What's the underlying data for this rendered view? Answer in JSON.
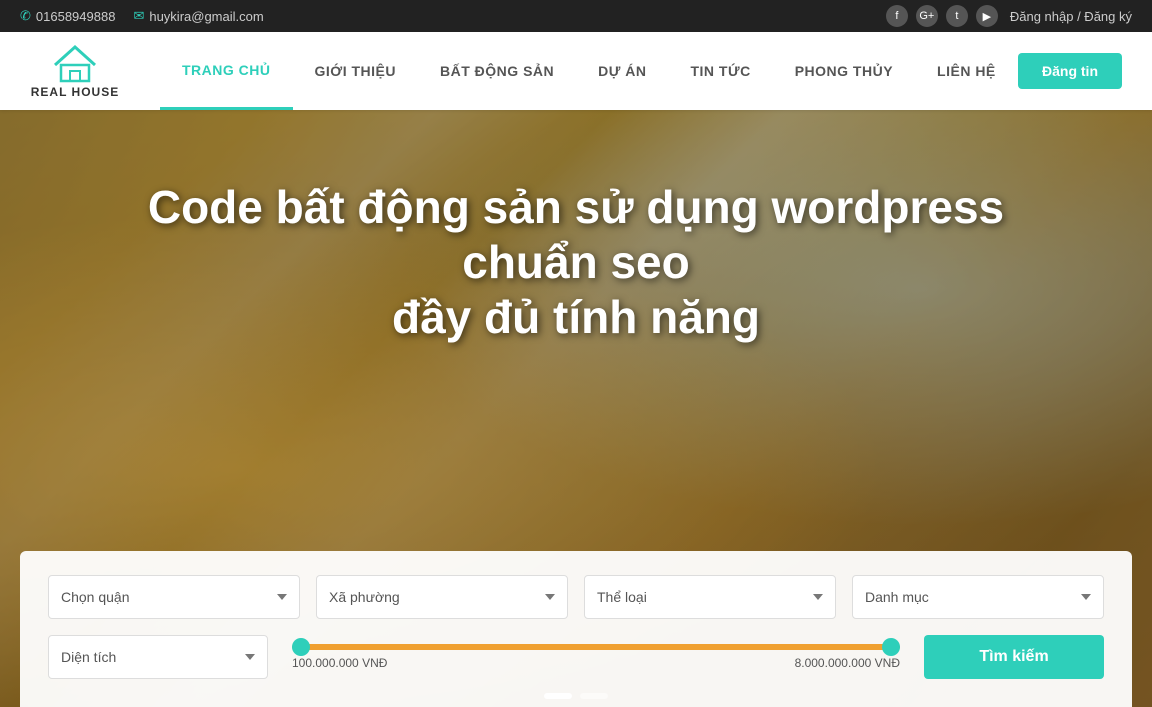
{
  "topbar": {
    "phone": "01658949888",
    "email": "huykira@gmail.com",
    "login": "Đăng nhập / Đăng ký",
    "socials": [
      "f",
      "G+",
      "t",
      "y"
    ]
  },
  "header": {
    "logo_text": "REAL HOUSE",
    "dang_tin": "Đăng tin",
    "nav": [
      {
        "label": "TRANG CHỦ",
        "active": true
      },
      {
        "label": "GIỚI THIỆU",
        "active": false
      },
      {
        "label": "BẤT ĐỘNG SẢN",
        "active": false
      },
      {
        "label": "DỰ ÁN",
        "active": false
      },
      {
        "label": "TIN TỨC",
        "active": false
      },
      {
        "label": "PHONG THỦY",
        "active": false
      },
      {
        "label": "LIÊN HỆ",
        "active": false
      }
    ]
  },
  "hero": {
    "title_line1": "Code bất động sản sử dụng wordpress chuẩn seo",
    "title_line2": "đầy đủ tính năng"
  },
  "search": {
    "select1": {
      "label": "Chọn quận",
      "placeholder": "Chọn quận"
    },
    "select2": {
      "label": "Xã phường",
      "placeholder": "Xã phường"
    },
    "select3": {
      "label": "Thể loại",
      "placeholder": "Thể loại"
    },
    "select4": {
      "label": "Danh mục",
      "placeholder": "Danh mục"
    },
    "select5": {
      "label": "Diện tích",
      "placeholder": "Diện tích"
    },
    "price_min": "100.000.000 VNĐ",
    "price_max": "8.000.000.000 VNĐ",
    "search_btn": "Tìm kiếm"
  },
  "carousel": {
    "dots": [
      {
        "active": true
      },
      {
        "active": false
      }
    ]
  }
}
